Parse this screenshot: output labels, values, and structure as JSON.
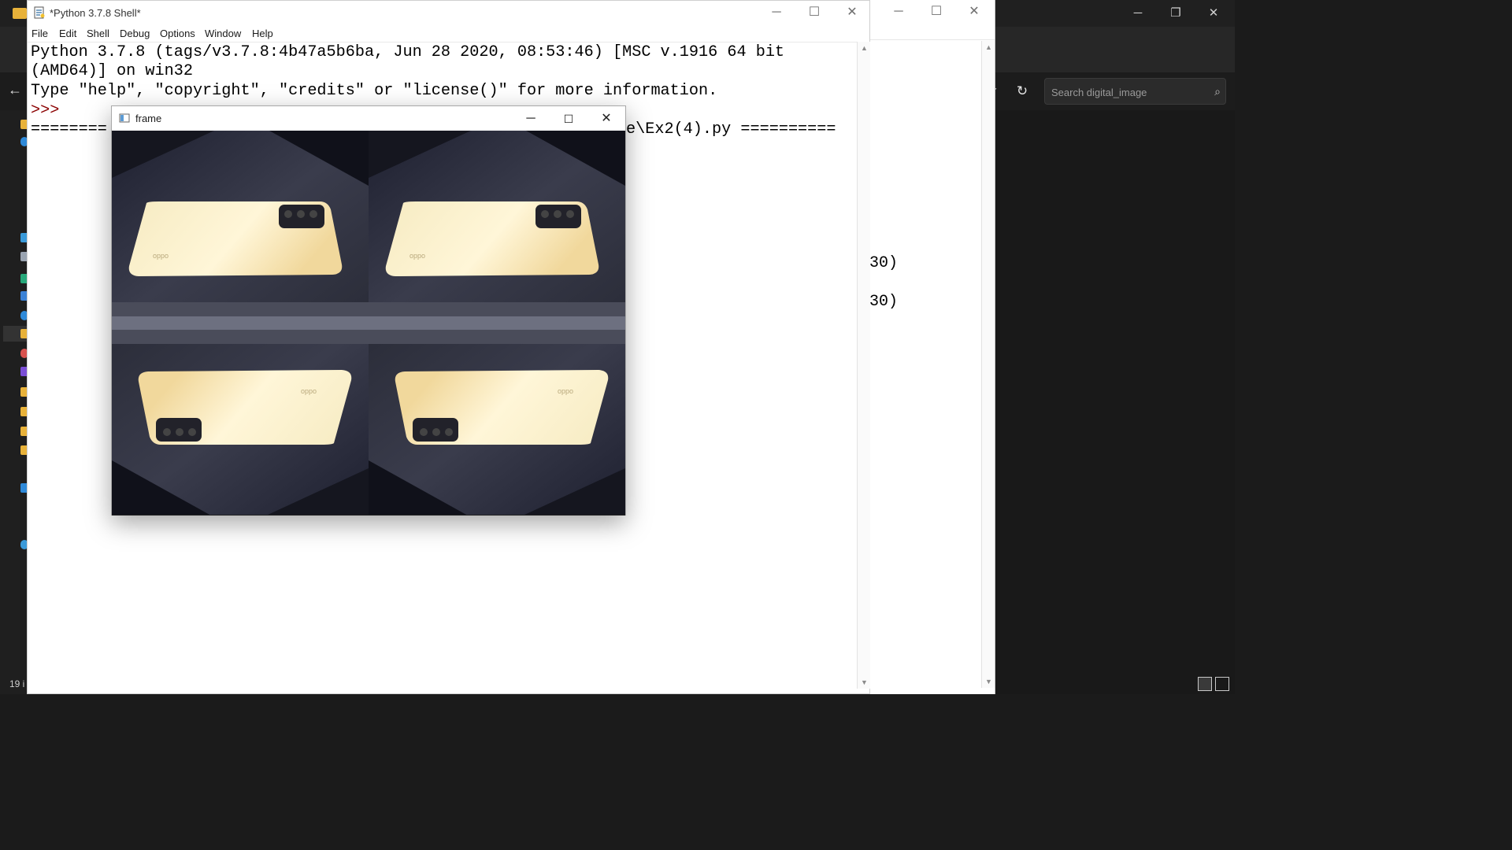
{
  "explorer": {
    "window_controls": {
      "minimize": "─",
      "restore": "❐",
      "close": "✕"
    },
    "refresh_glyph": "↻",
    "dropdown_glyph": "✓",
    "back_glyph": "←",
    "search": {
      "placeholder": "Search digital_image",
      "icon": "search-icon"
    },
    "status": {
      "item_count": "19 i"
    }
  },
  "idle_background": {
    "window_controls": {
      "minimize": "─",
      "maximize": "☐",
      "close": "✕"
    },
    "visible_text_lines": [
      "30)",
      "30)"
    ]
  },
  "shell": {
    "title": "*Python 3.7.8 Shell*",
    "window_controls": {
      "minimize": "─",
      "maximize": "☐",
      "close": "✕"
    },
    "menu": [
      "File",
      "Edit",
      "Shell",
      "Debug",
      "Options",
      "Window",
      "Help"
    ],
    "console_lines": [
      "Python 3.7.8 (tags/v3.7.8:4b47a5b6ba, Jun 28 2020, 08:53:46) [MSC v.1916 64 bit",
      "(AMD64)] on win32",
      "Type \"help\", \"copyright\", \"credits\" or \"license()\" for more information."
    ],
    "prompt": ">>>",
    "restart_line_left": "========",
    "restart_line_right": "e\\Ex2(4).py =========="
  },
  "frame_window": {
    "title": "frame",
    "window_controls": {
      "minimize": "─",
      "maximize": "☐",
      "close": "✕"
    },
    "phone_brand": "oppo"
  },
  "colors": {
    "explorer_bg": "#191919",
    "idle_bg": "#ffffff",
    "prompt": "#8b0000"
  }
}
